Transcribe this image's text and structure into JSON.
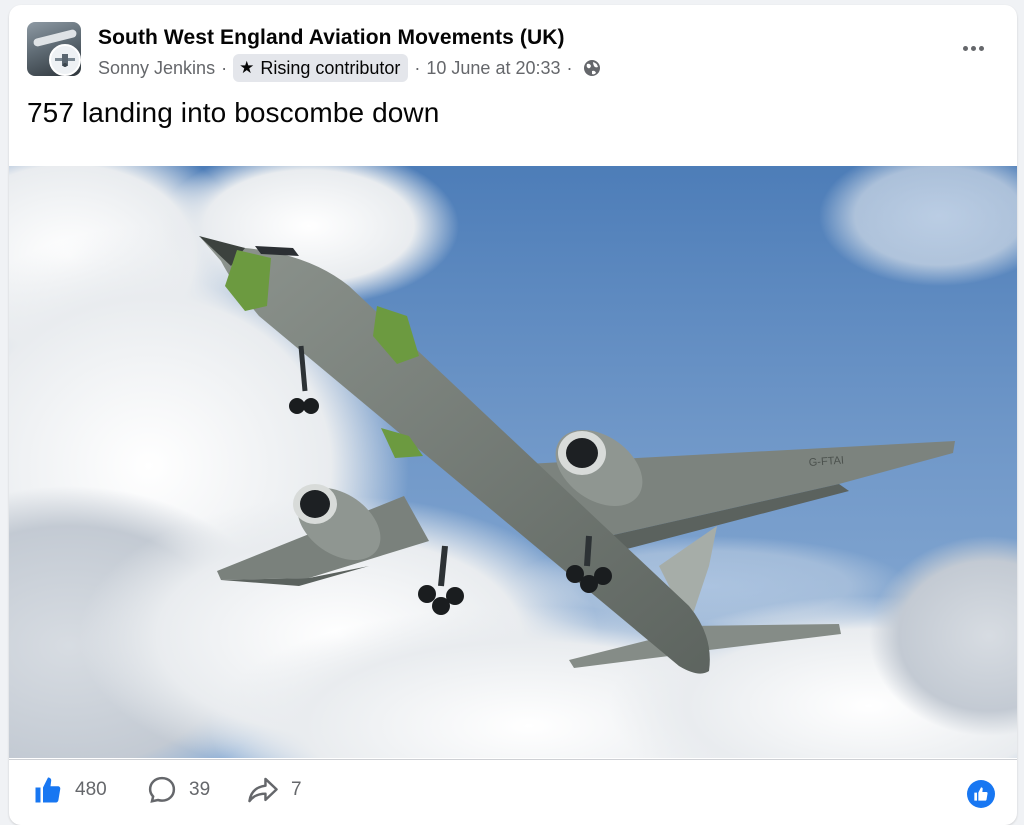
{
  "post": {
    "group_name": "South West England Aviation Movements (UK)",
    "author": "Sonny Jenkins",
    "badge_label": "Rising contributor",
    "timestamp": "10 June at 20:33",
    "text": "757 landing into boscombe down",
    "photo_registration": "G-FTAI"
  },
  "stats": {
    "likes": "480",
    "comments": "39",
    "shares": "7"
  },
  "icons": {
    "badge": "star-icon",
    "audience": "globe-icon",
    "more": "more-options-icon",
    "like": "like-icon",
    "comment": "comment-icon",
    "share": "share-icon",
    "reaction": "like-reaction-icon"
  },
  "colors": {
    "accent": "#1877f2",
    "secondary_text": "#65676b",
    "badge_bg": "#e4e6eb"
  }
}
